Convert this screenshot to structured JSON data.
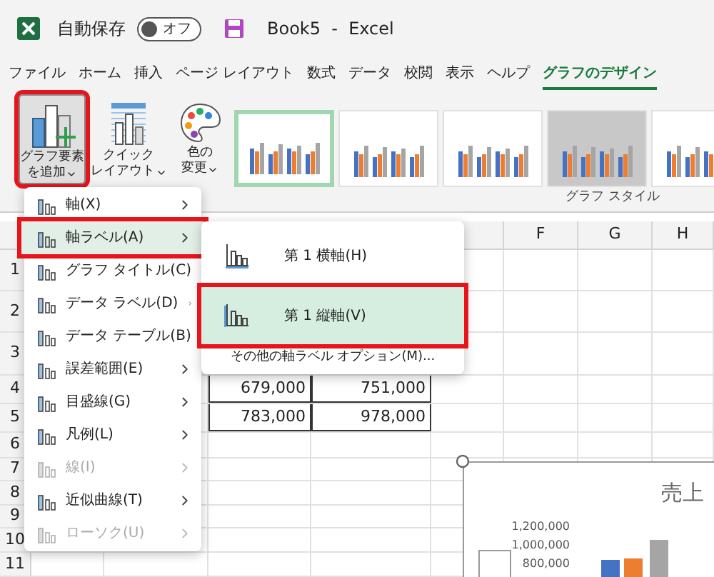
{
  "title_bar": {
    "autosave_label": "自動保存",
    "autosave_toggle": {
      "label": "オフ",
      "on": false
    },
    "document_title": "Book5  -  Excel"
  },
  "ribbon_tabs": [
    {
      "label": "ファイル",
      "selected": false
    },
    {
      "label": "ホーム",
      "selected": false
    },
    {
      "label": "挿入",
      "selected": false
    },
    {
      "label": "ページ レイアウト",
      "selected": false
    },
    {
      "label": "数式",
      "selected": false
    },
    {
      "label": "データ",
      "selected": false
    },
    {
      "label": "校閲",
      "selected": false
    },
    {
      "label": "表示",
      "selected": false
    },
    {
      "label": "ヘルプ",
      "selected": false
    },
    {
      "label": "グラフのデザイン",
      "selected": true
    }
  ],
  "ribbon": {
    "buttons": [
      {
        "kind": "add-element",
        "lines": [
          "グラフ要素",
          "を追加"
        ],
        "highlighted": true,
        "pressed": true
      },
      {
        "kind": "quick-layout",
        "lines": [
          "クイック",
          "レイアウト"
        ],
        "highlighted": false,
        "pressed": false
      },
      {
        "kind": "colors",
        "lines": [
          "色の",
          "変更"
        ],
        "highlighted": false,
        "pressed": false
      }
    ],
    "chart_styles": [
      {
        "kind": "white",
        "selected": true
      },
      {
        "kind": "white",
        "selected": false
      },
      {
        "kind": "white",
        "selected": false
      },
      {
        "kind": "gray",
        "selected": false
      },
      {
        "kind": "white",
        "selected": false
      }
    ],
    "style_group_label": "グラフ スタイル"
  },
  "sheet": {
    "column_headers": [
      "F",
      "G",
      "H"
    ],
    "row_headers": [
      "1",
      "2",
      "3",
      "4",
      "5",
      "6",
      "7",
      "8",
      "9",
      "10",
      "11"
    ],
    "table_rows": [
      {
        "cells": [
          "679,000",
          "751,000"
        ]
      },
      {
        "cells": [
          "783,000",
          "978,000"
        ]
      }
    ]
  },
  "chart": {
    "title": "売上",
    "axis_labels": [
      "1,200,000",
      "1,000,000",
      "800,000"
    ]
  },
  "add_element_menu": {
    "items": [
      {
        "label": "軸(X)",
        "disabled": false,
        "selected": false,
        "highlighted": false
      },
      {
        "label": "軸ラベル(A)",
        "disabled": false,
        "selected": true,
        "highlighted": true
      },
      {
        "label": "グラフ タイトル(C)",
        "disabled": false,
        "selected": false,
        "highlighted": false
      },
      {
        "label": "データ ラベル(D)",
        "disabled": false,
        "selected": false,
        "highlighted": false
      },
      {
        "label": "データ テーブル(B)",
        "disabled": false,
        "selected": false,
        "highlighted": false
      },
      {
        "label": "誤差範囲(E)",
        "disabled": false,
        "selected": false,
        "highlighted": false
      },
      {
        "label": "目盛線(G)",
        "disabled": false,
        "selected": false,
        "highlighted": false
      },
      {
        "label": "凡例(L)",
        "disabled": false,
        "selected": false,
        "highlighted": false
      },
      {
        "label": "線(I)",
        "disabled": true,
        "selected": false,
        "highlighted": false
      },
      {
        "label": "近似曲線(T)",
        "disabled": false,
        "selected": false,
        "highlighted": false
      },
      {
        "label": "ローソク(U)",
        "disabled": true,
        "selected": false,
        "highlighted": false
      }
    ]
  },
  "axis_label_submenu": {
    "items": [
      {
        "label": "第 1 横軸(H)",
        "selected": false,
        "highlighted": false
      },
      {
        "label": "第 1 縦軸(V)",
        "selected": true,
        "highlighted": true
      }
    ],
    "more_options": "その他の軸ラベル オプション(M)..."
  }
}
